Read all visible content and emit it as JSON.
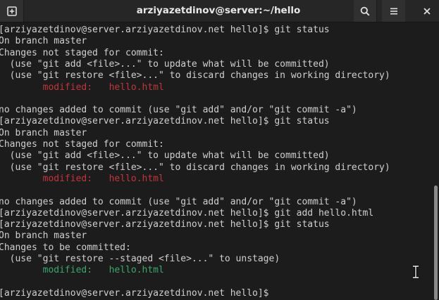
{
  "window": {
    "title": "arziyazetdinov@server:~/hello"
  },
  "icons": {
    "new_tab": "new-tab-icon",
    "search": "search-icon",
    "menu": "hamburger-menu-icon",
    "close": "close-icon",
    "cursor": "text-cursor-icon"
  },
  "colors": {
    "modified": "#c2353a",
    "staged": "#3aa86b",
    "text": "#d0d0d0",
    "background": "#1c1c1c"
  },
  "terminal": {
    "lines": [
      {
        "text": "[arziyazetdinov@server.arziyazetdinov.net hello]$ git status"
      },
      {
        "text": "On branch master"
      },
      {
        "text": "Changes not staged for commit:"
      },
      {
        "text": "  (use \"git add <file>...\" to update what will be committed)"
      },
      {
        "text": "  (use \"git restore <file>...\" to discard changes in working directory)"
      },
      {
        "indent": "        ",
        "label": "modified:",
        "gap": "   ",
        "file": "hello.html",
        "color": "red"
      },
      {
        "text": ""
      },
      {
        "text": "no changes added to commit (use \"git add\" and/or \"git commit -a\")"
      },
      {
        "text": "[arziyazetdinov@server.arziyazetdinov.net hello]$ git status"
      },
      {
        "text": "On branch master"
      },
      {
        "text": "Changes not staged for commit:"
      },
      {
        "text": "  (use \"git add <file>...\" to update what will be committed)"
      },
      {
        "text": "  (use \"git restore <file>...\" to discard changes in working directory)"
      },
      {
        "indent": "        ",
        "label": "modified:",
        "gap": "   ",
        "file": "hello.html",
        "color": "red"
      },
      {
        "text": ""
      },
      {
        "text": "no changes added to commit (use \"git add\" and/or \"git commit -a\")"
      },
      {
        "text": "[arziyazetdinov@server.arziyazetdinov.net hello]$ git add hello.html"
      },
      {
        "text": "[arziyazetdinov@server.arziyazetdinov.net hello]$ git status"
      },
      {
        "text": "On branch master"
      },
      {
        "text": "Changes to be committed:"
      },
      {
        "text": "  (use \"git restore --staged <file>...\" to unstage)"
      },
      {
        "indent": "        ",
        "label": "modified:",
        "gap": "   ",
        "file": "hello.html",
        "color": "green"
      },
      {
        "text": ""
      },
      {
        "text": "[arziyazetdinov@server.arziyazetdinov.net hello]$"
      }
    ]
  }
}
